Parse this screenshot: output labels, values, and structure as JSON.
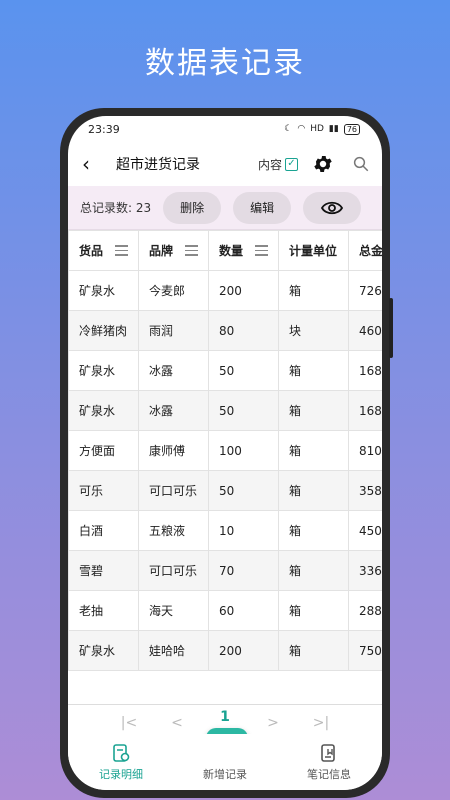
{
  "promo": {
    "title": "数据表记录"
  },
  "status": {
    "time": "23:39",
    "signal": "HD",
    "battery": "76"
  },
  "appbar": {
    "title": "超市进货记录",
    "content_label": "内容",
    "content_checked": "✓"
  },
  "toolbar": {
    "count_label": "总记录数: 23",
    "delete_label": "删除",
    "edit_label": "编辑"
  },
  "table": {
    "headers": [
      "货品",
      "品牌",
      "数量",
      "计量单位",
      "总金"
    ],
    "rows": [
      [
        "矿泉水",
        "今麦郎",
        "200",
        "箱",
        "726"
      ],
      [
        "冷鲜猪肉",
        "雨润",
        "80",
        "块",
        "460"
      ],
      [
        "矿泉水",
        "冰露",
        "50",
        "箱",
        "168"
      ],
      [
        "矿泉水",
        "冰露",
        "50",
        "箱",
        "168"
      ],
      [
        "方便面",
        "康师傅",
        "100",
        "箱",
        "810"
      ],
      [
        "可乐",
        "可口可乐",
        "50",
        "箱",
        "358"
      ],
      [
        "白酒",
        "五粮液",
        "10",
        "箱",
        "450"
      ],
      [
        "雪碧",
        "可口可乐",
        "70",
        "箱",
        "336"
      ],
      [
        "老抽",
        "海天",
        "60",
        "箱",
        "288"
      ],
      [
        "矿泉水",
        "娃哈哈",
        "200",
        "箱",
        "750"
      ]
    ]
  },
  "pager": {
    "first": "|<",
    "prev": "<",
    "current": "1",
    "next": ">",
    "last": ">|"
  },
  "nav": {
    "records": "记录明细",
    "add": "新增记录",
    "notes": "笔记信息",
    "fab": "+"
  },
  "colors": {
    "accent": "#1aa392",
    "toolbar_bg": "#f5ebf5"
  }
}
